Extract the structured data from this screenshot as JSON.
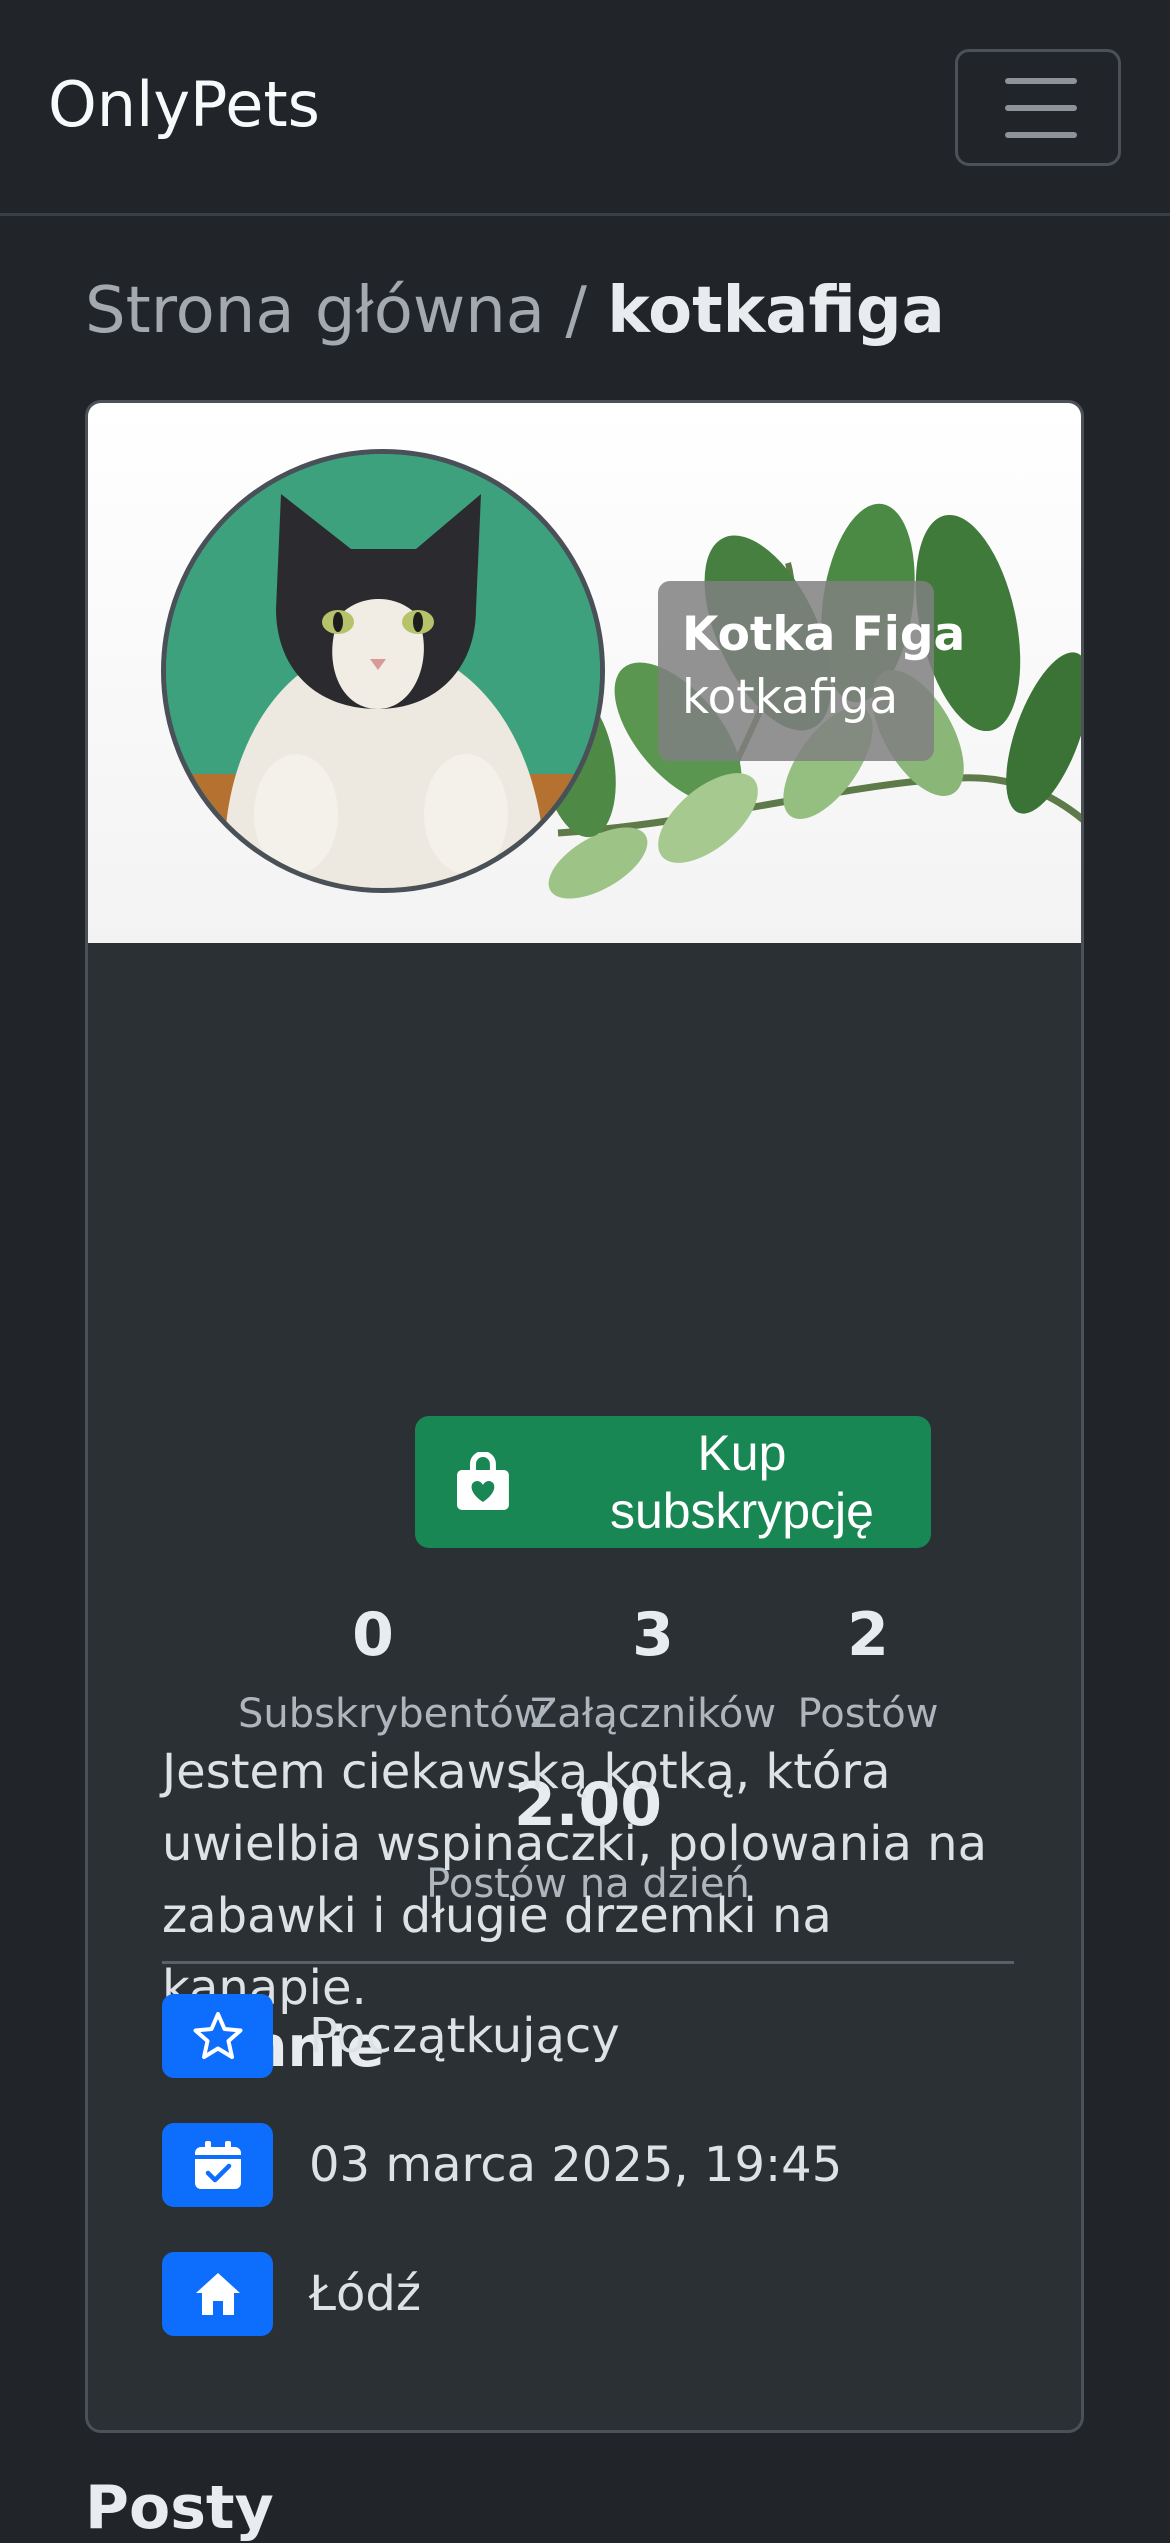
{
  "navbar": {
    "brand": "OnlyPets"
  },
  "breadcrumb": {
    "home": "Strona główna",
    "separator": "/",
    "current": "kotkafiga"
  },
  "profile": {
    "display_name": "Kotka Figa",
    "username": "kotkafiga",
    "subscribe_label": "Kup subskrypcję",
    "stats": [
      {
        "value": "0",
        "label": "Subskrybentów"
      },
      {
        "value": "3",
        "label": "Załączników"
      },
      {
        "value": "2",
        "label": "Postów"
      },
      {
        "value": "2.00",
        "label": "Postów na dzień"
      }
    ],
    "about": {
      "heading": "O mnie",
      "text": "Jestem ciekawską kotką, która uwielbia wspinaczki, polowania na zabawki i długie drzemki na kanapie.",
      "items": [
        {
          "icon": "star-icon",
          "text": "Początkujący"
        },
        {
          "icon": "calendar-check-icon",
          "text": "03 marca 2025, 19:45"
        },
        {
          "icon": "house-icon",
          "text": "Łódź"
        }
      ]
    }
  },
  "posts": {
    "heading": "Posty"
  },
  "colors": {
    "background": "#212529",
    "card": "#2b3035",
    "success": "#198754",
    "primary": "#0d6efd"
  }
}
